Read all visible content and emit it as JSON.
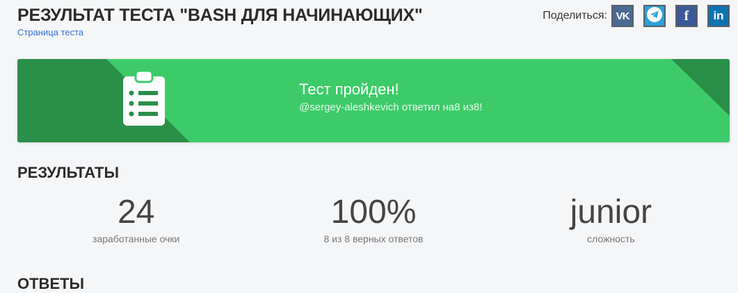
{
  "header": {
    "title": "РЕЗУЛЬТАТ ТЕСТА \"BASH ДЛЯ НАЧИНАЮЩИХ\"",
    "test_page_link": "Страница теста",
    "share_label": "Поделиться:",
    "share_buttons": [
      {
        "name": "vk",
        "icon": "vk-icon",
        "glyph": "VK",
        "color": "#4a6a95"
      },
      {
        "name": "telegram",
        "icon": "telegram-icon",
        "glyph": "",
        "color": "#2aa1da"
      },
      {
        "name": "facebook",
        "icon": "facebook-icon",
        "glyph": "f",
        "color": "#3b5998"
      },
      {
        "name": "linkedin",
        "icon": "linkedin-icon",
        "glyph": "in",
        "color": "#0a74b3"
      }
    ]
  },
  "banner": {
    "icon": "clipboard-list-icon",
    "title": "Тест пройден!",
    "subtitle": "@sergey-aleshkevich ответил на8 из8!",
    "color": "#3dcb69",
    "accent_color": "#2a8f48"
  },
  "results": {
    "title": "РЕЗУЛЬТАТЫ",
    "stats": [
      {
        "value": "24",
        "label": "заработанные очки"
      },
      {
        "value": "100%",
        "label": "8 из 8 верных ответов"
      },
      {
        "value": "junior",
        "label": "сложность"
      }
    ]
  },
  "answers": {
    "title": "ОТВЕТЫ"
  }
}
